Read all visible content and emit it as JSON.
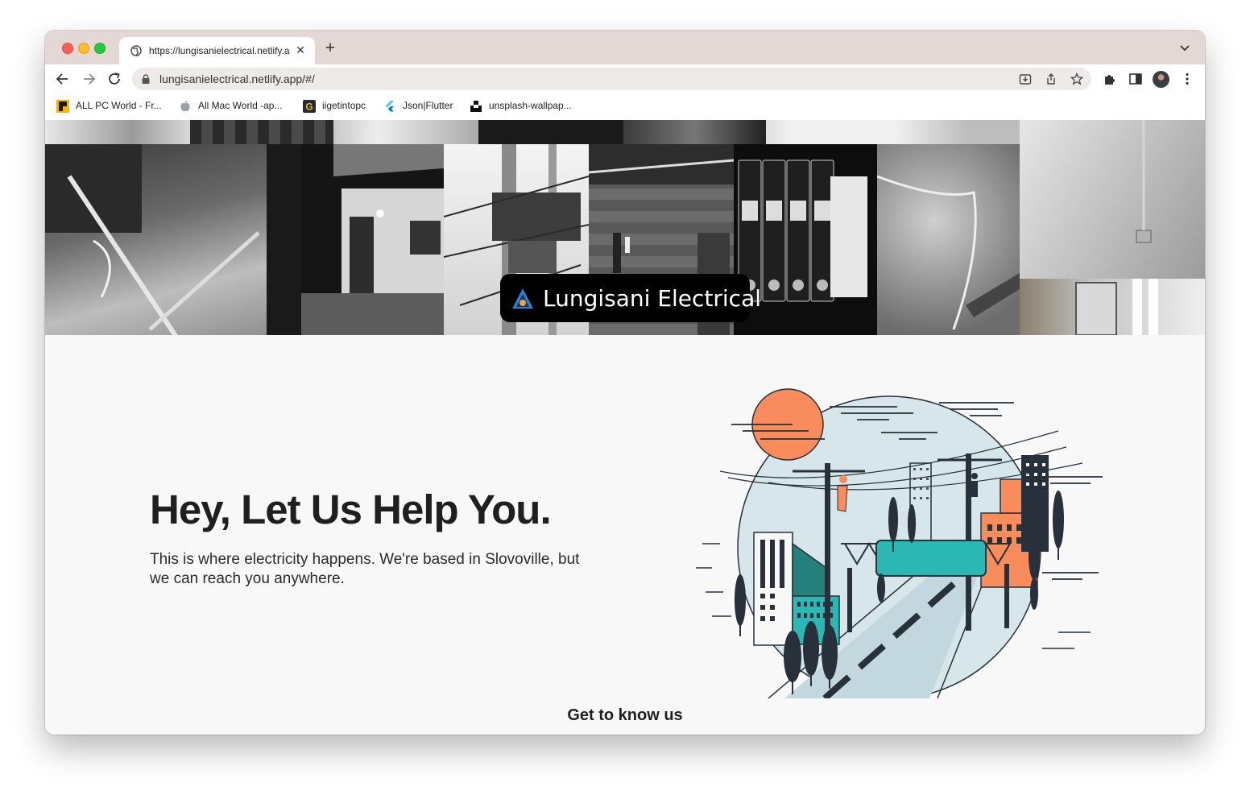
{
  "browser": {
    "tab": {
      "title": "https://lungisanielectrical.netlify.app/#/",
      "close_label": "✕"
    },
    "new_tab_label": "+",
    "url": "lungisanielectrical.netlify.app/#/"
  },
  "bookmarks": [
    {
      "label": "ALL PC World - Fr...",
      "icon": "pc-world-icon"
    },
    {
      "label": "All Mac World  -ap...",
      "icon": "apple-icon"
    },
    {
      "label": "iigetintopc",
      "icon": "g-logo-icon"
    },
    {
      "label": "Json|Flutter",
      "icon": "flutter-icon"
    },
    {
      "label": "unsplash-wallpap...",
      "icon": "unsplash-icon"
    }
  ],
  "header": {
    "brand_name": "Lungisani Electrical"
  },
  "hero": {
    "title": "Hey, Let Us Help You.",
    "subtitle": "This is where electricity happens. We're based in Slovoville, but we can reach you anywhere."
  },
  "cta": {
    "label": "Get to know us"
  },
  "colors": {
    "accent_orange": "#f98c5c",
    "accent_teal": "#2bb8b4",
    "circle_bg": "#d6e6ea",
    "dark": "#27303b"
  }
}
